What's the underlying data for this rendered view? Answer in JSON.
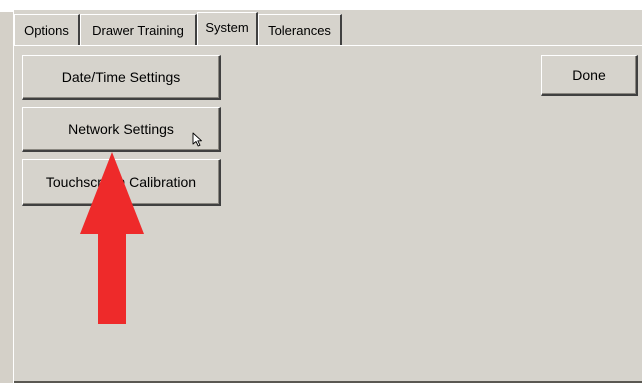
{
  "tabs": [
    {
      "label": "Options"
    },
    {
      "label": "Drawer Training"
    },
    {
      "label": "System"
    },
    {
      "label": "Tolerances"
    }
  ],
  "active_tab": "System",
  "buttons": {
    "datetime": "Date/Time Settings",
    "network": "Network Settings",
    "touchscreen": "Touchscreen Calibration",
    "done": "Done"
  },
  "colors": {
    "panel": "#d6d3cc",
    "annotation_arrow": "#ee2a2a"
  },
  "icons": {
    "cursor": "mouse-pointer-icon",
    "annotation": "red-up-arrow-icon"
  }
}
